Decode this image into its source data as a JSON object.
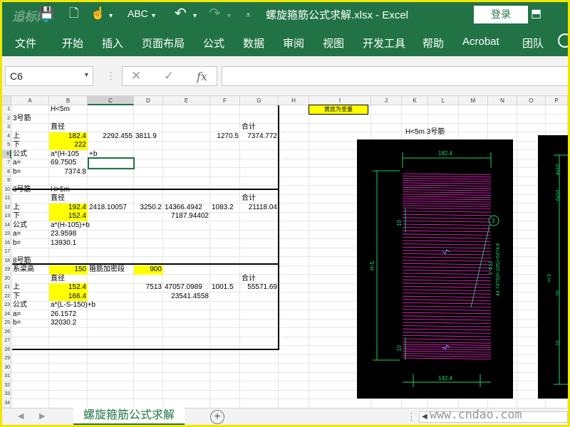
{
  "app": {
    "title": "螺旋箍筋公式求解.xlsx - Excel",
    "login": "登录",
    "watermark_top": "追标网",
    "watermark_bottom": "www.cndao.com"
  },
  "menu": [
    "文件",
    "开始",
    "插入",
    "页面布局",
    "公式",
    "数据",
    "审阅",
    "视图",
    "开发工具",
    "帮助",
    "Acrobat",
    "团队"
  ],
  "formula_bar": {
    "name_box": "C6",
    "cancel": "✕",
    "enter": "✓",
    "fx": "fx",
    "formula": ""
  },
  "columns": [
    "A",
    "B",
    "C",
    "D",
    "E",
    "F",
    "G",
    "H",
    "I",
    "J",
    "K",
    "L",
    "M",
    "N",
    "O",
    "P"
  ],
  "rows": [
    "1",
    "2",
    "3",
    "4",
    "5",
    "6",
    "7",
    "8",
    "9",
    "10",
    "11",
    "12",
    "13",
    "14",
    "15",
    "16",
    "17",
    "18",
    "19",
    "20",
    "21",
    "22",
    "23",
    "24",
    "25",
    "26",
    "27",
    "28",
    "29",
    "30",
    "31",
    "32",
    "33",
    "34"
  ],
  "sheet_cells": {
    "s1_h": "H<5m",
    "s1_title": "3号筋",
    "s1_dia": "直径",
    "s1_total": "合计",
    "s1_up": "上",
    "s1_up_b": "182.4",
    "s1_up_c": "2292.455",
    "s1_up_d": "3811.9",
    "s1_up_f": "1270.5",
    "s1_up_g": "7374.772",
    "s1_down": "下",
    "s1_down_b": "222",
    "s1_formula_l": "公式",
    "s1_formula": "a*(H-105",
    "s1_formula_c": "+b",
    "s1_a": "a=",
    "s1_a_v": "69.7505",
    "s1_b": "b=",
    "s1_b_v": "7374.8",
    "s2_title": "3号筋",
    "s2_h": "H>5m",
    "s2_dia": "直径",
    "s2_total": "合计",
    "s2_up": "上",
    "s2_up_b": "192.4",
    "s2_up_c": "2418.10057",
    "s2_up_d": "3250.2",
    "s2_up_e": "14366.4942",
    "s2_up_f": "1083.2",
    "s2_up_g": "21118.04",
    "s2_down": "下",
    "s2_down_b": "152.4",
    "s2_down_e": "7187.94402",
    "s2_formula_l": "公式",
    "s2_formula": "a*(H-105)+b",
    "s2_a": "a=",
    "s2_a_v": "23.9598",
    "s2_b": "b=",
    "s2_b_v": "13930.1",
    "s3_title": "8号筋",
    "s3_beam": "系梁高",
    "s3_beam_b": "150",
    "s3_dense": "箍筋加密段",
    "s3_dense_d": "900",
    "s3_dia": "直径",
    "s3_total": "合计",
    "s3_up": "上",
    "s3_up_b": "152.4",
    "s3_up_d": "7513",
    "s3_up_e": "47057.0989",
    "s3_up_f": "1001.5",
    "s3_up_g": "55571.69",
    "s3_down": "下",
    "s3_down_b": "166.4",
    "s3_down_e": "23541.4558",
    "s3_formula_l": "公式",
    "s3_formula": "a*(L-S-150)+b",
    "s3_a": "a=",
    "s3_a_v": "26.1572",
    "s3_b": "b=",
    "s3_b_v": "32030.2",
    "note": "黄底为变量",
    "img_label": "H<5m  3号筋"
  },
  "drawing": {
    "top_dim": "182.4",
    "bottom_dim": "142.4",
    "side_label": "H-5",
    "spacing_top": "10",
    "spacing_bottom": "10",
    "bar_mark": "3",
    "bar_note": "2 Φ12",
    "bar_formula": "44.7475(H-105)+6374.6"
  },
  "drawing2": {
    "d1": "4x10",
    "d2": "6x10",
    "d3": "H-5",
    "d4": "20",
    "d5": "10"
  },
  "sheet_tab": "螺旋箍筋公式求解",
  "colors": {
    "excel_green": "#217346",
    "highlight": "#ffff00",
    "rebar": "#ff2bd6",
    "dim": "#19d46b"
  }
}
